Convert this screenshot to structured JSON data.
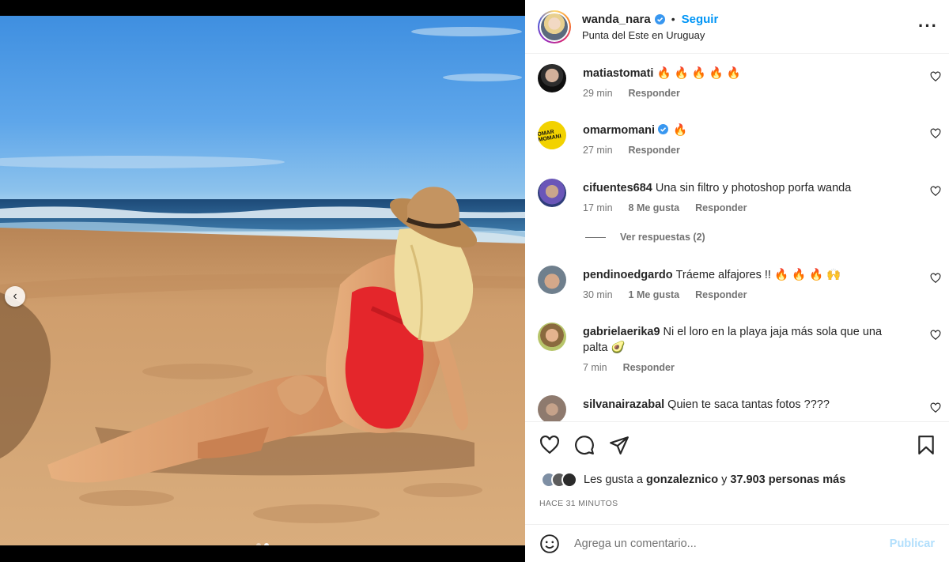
{
  "post": {
    "username": "wanda_nara",
    "separator": "•",
    "follow_label": "Seguir",
    "location": "Punta del Este en Uruguay",
    "more_label": "···"
  },
  "media": {
    "prev_label": "‹",
    "slide_count": 2,
    "active_slide": 2
  },
  "comments": [
    {
      "user": "matiastomati",
      "text": "🔥 🔥 🔥 🔥 🔥",
      "time": "29 min",
      "likes": "",
      "reply": "Responder",
      "verified": false
    },
    {
      "user": "omarmomani",
      "text": "🔥",
      "time": "27 min",
      "likes": "",
      "reply": "Responder",
      "verified": true
    },
    {
      "user": "cifuentes684",
      "text": "Una sin filtro y photoshop porfa wanda",
      "time": "17 min",
      "likes": "8 Me gusta",
      "reply": "Responder",
      "verified": false,
      "view_replies": "Ver respuestas (2)"
    },
    {
      "user": "pendinoedgardo",
      "text": "Tráeme alfajores !! 🔥 🔥 🔥 🙌",
      "time": "30 min",
      "likes": "1 Me gusta",
      "reply": "Responder",
      "verified": false
    },
    {
      "user": "gabrielaerika9",
      "text": "Ni el loro en la playa jaja más sola que una palta 🥑",
      "time": "7 min",
      "likes": "",
      "reply": "Responder",
      "verified": false
    },
    {
      "user": "silvanairazabal",
      "text": "Quien te saca tantas fotos ????",
      "time": "",
      "likes": "",
      "reply": "",
      "verified": false
    }
  ],
  "likes": {
    "prefix": "Les gusta a",
    "user": "gonzaleznico",
    "connector": "y",
    "count": "37.903 personas más"
  },
  "time_ago": "HACE 31 MINUTOS",
  "add_comment": {
    "placeholder": "Agrega un comentario...",
    "publish_label": "Publicar"
  },
  "colors": {
    "accent": "#0095f6",
    "verified": "#3897f0",
    "publish_disabled": "#b2dffc",
    "muted": "#737373"
  },
  "icons": [
    "heart-icon",
    "comment-icon",
    "share-icon",
    "bookmark-icon",
    "emoji-icon",
    "verified-icon",
    "chevron-left-icon"
  ]
}
